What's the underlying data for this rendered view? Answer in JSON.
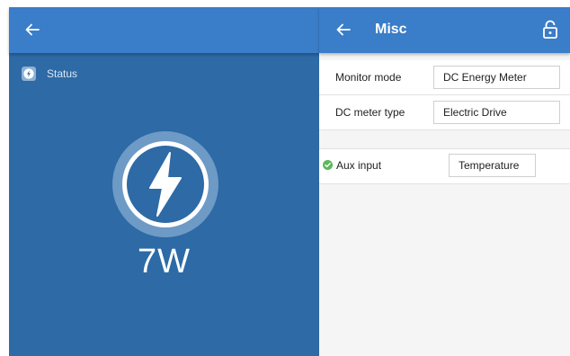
{
  "left": {
    "status_label": "Status",
    "power_value": "7W"
  },
  "right": {
    "title": "Misc",
    "settings": [
      {
        "label": "Monitor mode",
        "value": "DC Energy Meter"
      },
      {
        "label": "DC meter type",
        "value": "Electric Drive"
      },
      {
        "label": "Aux input",
        "value": "Temperature"
      }
    ]
  },
  "icons": {
    "left_back": "arrow-left-icon",
    "status": "lightning-icon",
    "gauge": "lightning-bolt-icon",
    "right_back": "arrow-left-icon",
    "lock": "padlock-open-icon",
    "check": "check-circle-icon"
  },
  "colors": {
    "header_blue": "#3a7dc8",
    "panel_blue": "#2d6aa6",
    "check_green": "#5cb85c"
  }
}
